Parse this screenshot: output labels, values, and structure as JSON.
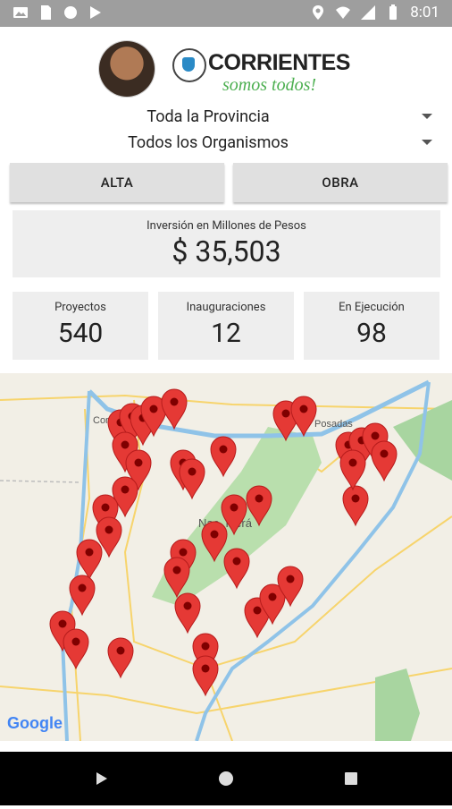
{
  "status_bar": {
    "time": "8:01",
    "icons": [
      "photo-icon",
      "sim-icon",
      "circle-icon",
      "play-store-icon",
      "location-icon",
      "wifi-icon",
      "signal-icon",
      "battery-icon"
    ]
  },
  "header": {
    "logo_title": "CORRIENTES",
    "logo_subtitle": "somos todos!"
  },
  "filters": {
    "province": "Toda la Provincia",
    "organismos": "Todos los Organismos"
  },
  "buttons": {
    "alta": "ALTA",
    "obra": "OBRA"
  },
  "investment": {
    "label": "Inversión en Millones de Pesos",
    "value": "$ 35,503"
  },
  "stats": [
    {
      "label": "Proyectos",
      "value": "540"
    },
    {
      "label": "Inauguraciones",
      "value": "12"
    },
    {
      "label": "En Ejecución",
      "value": "98"
    }
  ],
  "map": {
    "places": [
      "Cor",
      "Posadas",
      "Nac. Iberá"
    ],
    "attribution": "Google",
    "marker_color": "#e53935"
  },
  "nav": [
    "back-icon",
    "home-icon",
    "recents-icon"
  ]
}
